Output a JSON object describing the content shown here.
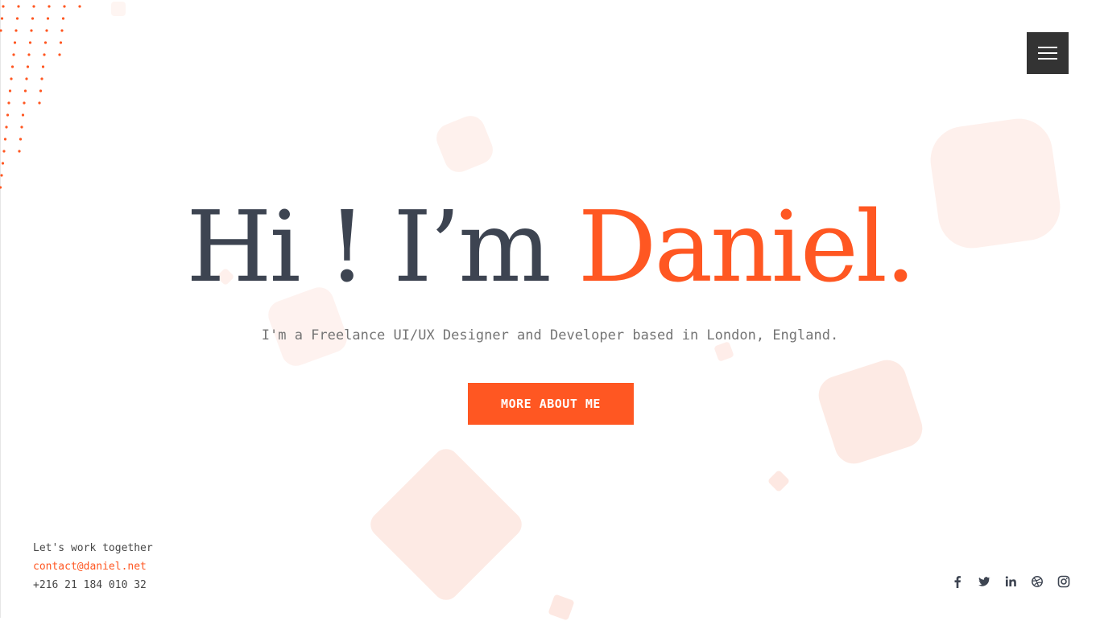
{
  "header": {
    "menu_icon": "hamburger-menu-icon"
  },
  "hero": {
    "greeting": "Hi ! I’m ",
    "name": "Daniel.",
    "subtitle": "I'm a Freelance UI/UX Designer and Developer based in London, England.",
    "cta_label": "MORE ABOUT ME"
  },
  "contact": {
    "tagline": "Let's work together",
    "email": "contact@daniel.net",
    "phone": "+216 21 184 010 32"
  },
  "social": [
    {
      "icon": "facebook-icon"
    },
    {
      "icon": "twitter-icon"
    },
    {
      "icon": "linkedin-icon"
    },
    {
      "icon": "dribbble-icon"
    },
    {
      "icon": "instagram-icon"
    }
  ],
  "colors": {
    "accent": "#ff5722",
    "heading": "#3d4451",
    "text": "#747474",
    "menu_bg": "#333333",
    "shape": "#fde6df"
  }
}
